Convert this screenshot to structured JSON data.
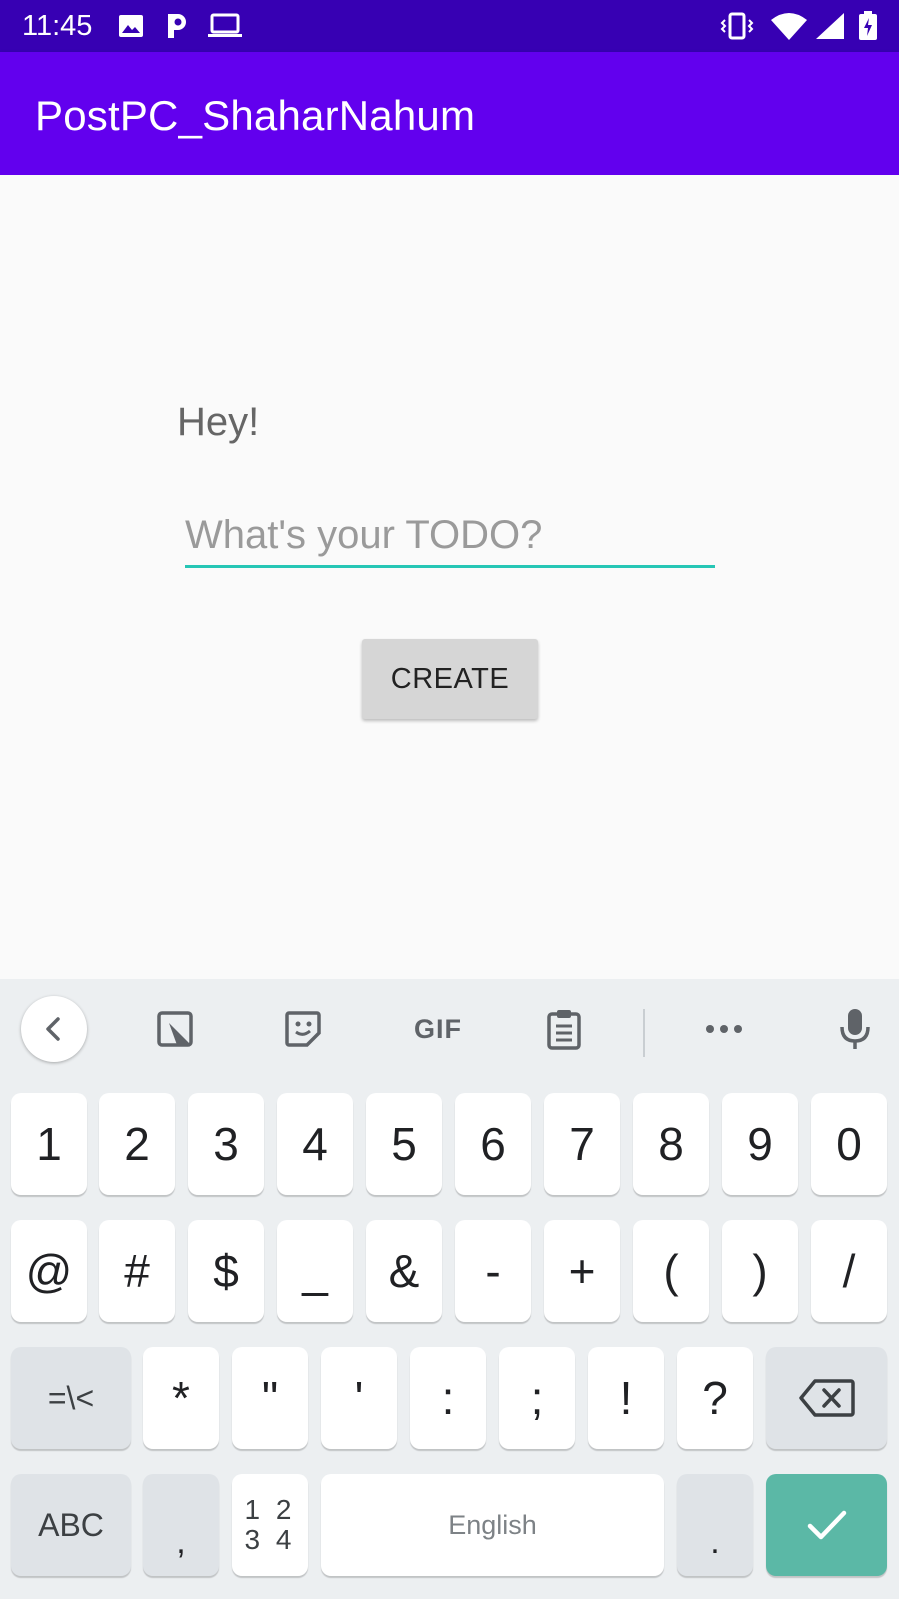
{
  "status_bar": {
    "time": "11:45",
    "icons": [
      "image-icon",
      "p-app-icon",
      "laptop-icon",
      "vibrate-icon",
      "wifi-icon",
      "signal-icon",
      "battery-charging-icon"
    ]
  },
  "app_bar": {
    "title": "PostPC_ShaharNahum"
  },
  "main": {
    "greeting": "Hey!",
    "todo_placeholder": "What's your TODO?",
    "create_label": "CREATE"
  },
  "keyboard": {
    "toolbar": [
      "back-icon",
      "resize-icon",
      "sticker-icon",
      "GIF",
      "clipboard-icon",
      "more-icon",
      "mic-icon"
    ],
    "gif_label": "GIF",
    "row1": [
      "1",
      "2",
      "3",
      "4",
      "5",
      "6",
      "7",
      "8",
      "9",
      "0"
    ],
    "row2": [
      "@",
      "#",
      "$",
      "_",
      "&",
      "-",
      "+",
      "(",
      ")",
      "/"
    ],
    "row3": {
      "toggle": "=\\<",
      "keys": [
        "*",
        "\"",
        "'",
        ":",
        ";",
        "!",
        "?"
      ],
      "backspace_icon": "backspace-icon"
    },
    "row4": {
      "abc": "ABC",
      "comma": ",",
      "numpad_top": "1 2",
      "numpad_bottom": "3 4",
      "space": "English",
      "period": ".",
      "enter_icon": "check-icon"
    },
    "accent_color": "#5bb8a6"
  },
  "colors": {
    "status_bar": "#3700b3",
    "app_bar": "#6200ee",
    "input_underline": "#26c6b5"
  }
}
